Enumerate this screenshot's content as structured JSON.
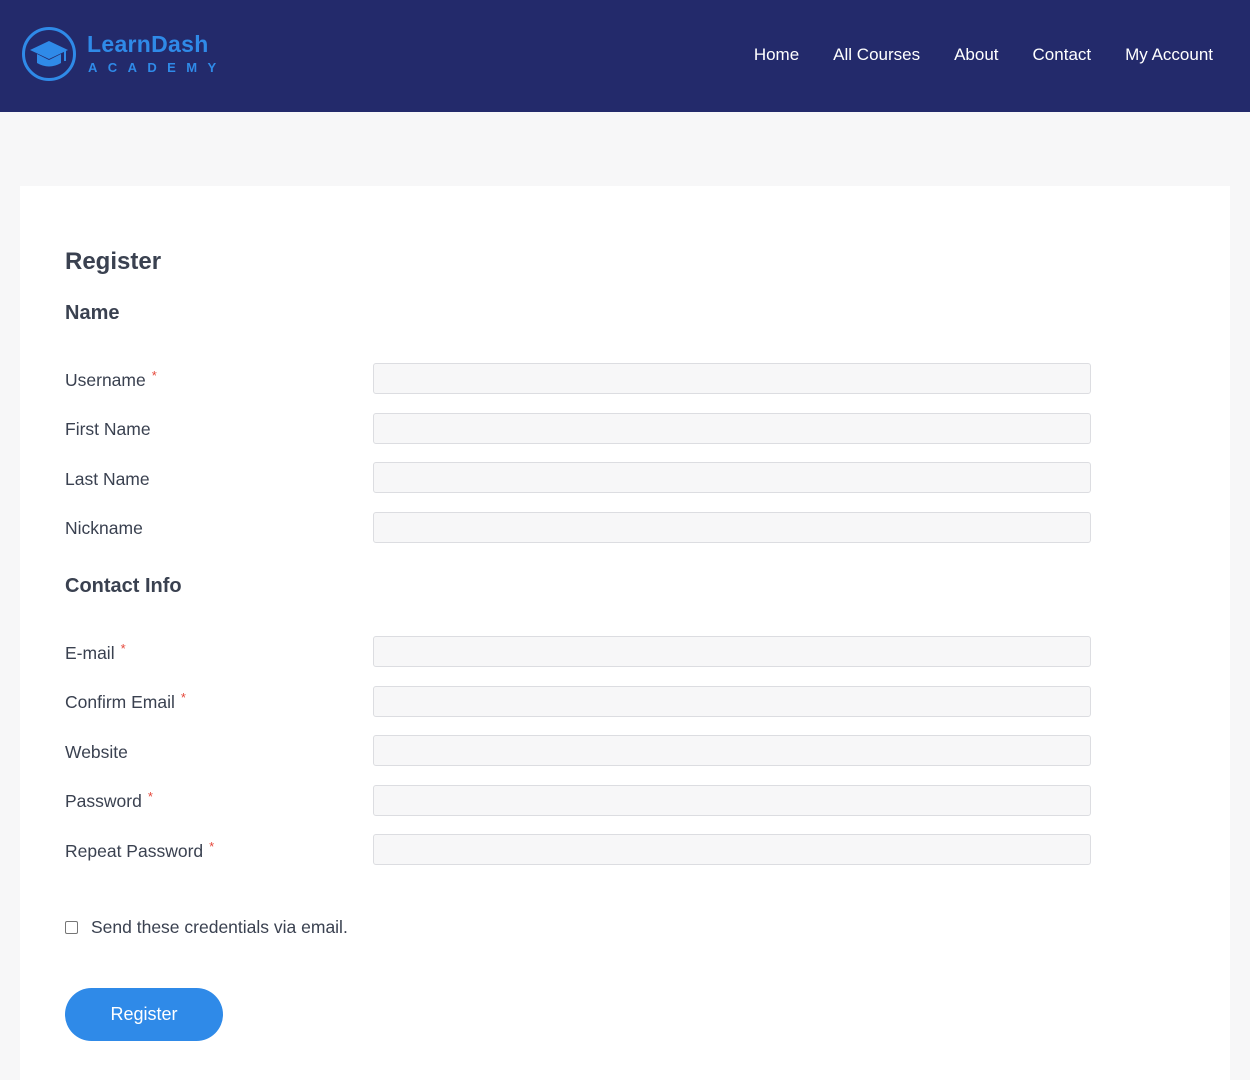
{
  "header": {
    "logo": {
      "name": "LearnDash",
      "sub": "ACADEMY"
    },
    "nav": [
      {
        "label": "Home"
      },
      {
        "label": "All Courses"
      },
      {
        "label": "About"
      },
      {
        "label": "Contact"
      },
      {
        "label": "My Account"
      }
    ]
  },
  "form": {
    "title": "Register",
    "sections": {
      "name": "Name",
      "contact": "Contact Info"
    },
    "required_mark": "*",
    "fields": {
      "username": {
        "label": "Username",
        "value": "",
        "required": true
      },
      "first_name": {
        "label": "First Name",
        "value": "",
        "required": false
      },
      "last_name": {
        "label": "Last Name",
        "value": "",
        "required": false
      },
      "nickname": {
        "label": "Nickname",
        "value": "",
        "required": false
      },
      "email": {
        "label": "E-mail",
        "value": "",
        "required": true
      },
      "confirm_email": {
        "label": "Confirm Email",
        "value": "",
        "required": true
      },
      "website": {
        "label": "Website",
        "value": "",
        "required": false
      },
      "password": {
        "label": "Password",
        "value": "",
        "required": true
      },
      "repeat_password": {
        "label": "Repeat Password",
        "value": "",
        "required": true
      }
    },
    "send_credentials": {
      "label": "Send these credentials via email.",
      "checked": false
    },
    "submit_label": "Register"
  },
  "colors": {
    "header_bg": "#232a6b",
    "accent": "#2f8ae8",
    "required": "#e5483b"
  }
}
